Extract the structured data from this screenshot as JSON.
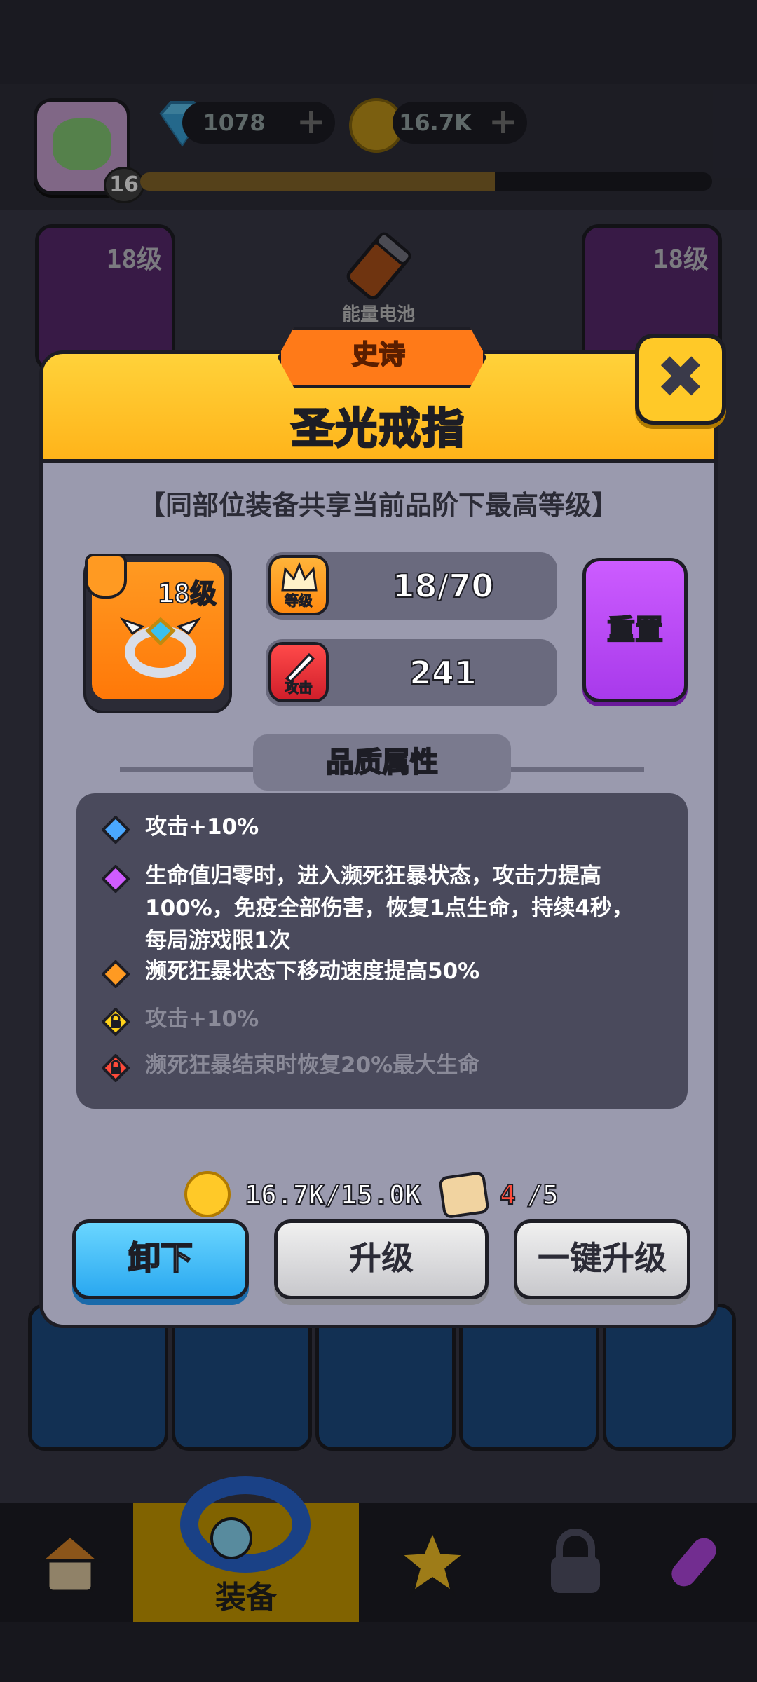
{
  "topbar": {
    "player_level": "16",
    "gems": "1078",
    "gold": "16.7K",
    "xp_progress": 0.62
  },
  "background": {
    "cards": [
      {
        "label": "18级",
        "color": "purple"
      },
      {
        "label": "18级",
        "color": "purple"
      }
    ],
    "battery_label": "能量电池"
  },
  "dialog": {
    "rarity": "史诗",
    "title": "圣光戒指",
    "share_note": "【同部位装备共享当前品阶下最高等级】",
    "item": {
      "level_label": "18级",
      "icon": "ring-icon"
    },
    "stats": {
      "level": {
        "icon_label": "等级",
        "value": "18/70"
      },
      "attack": {
        "icon_label": "攻击",
        "value": "241"
      }
    },
    "reset_label": "重置",
    "quality_header": "品质属性",
    "attributes": [
      {
        "text": "攻击+10%",
        "bullet": "blue-diamond",
        "locked": false
      },
      {
        "text": "生命值归零时，进入濒死狂暴状态，攻击力提高",
        "bullet": "purple-diamond",
        "locked": false
      },
      {
        "text": "100%，免疫全部伤害，恢复1点生命，持续4秒，",
        "bullet": "",
        "locked": false
      },
      {
        "text": "每局游戏限1次",
        "bullet": "",
        "locked": false
      },
      {
        "text": "濒死狂暴状态下移动速度提高50%",
        "bullet": "orange-diamond",
        "locked": false
      },
      {
        "text": "攻击+10%",
        "bullet": "yellow-lock",
        "locked": true
      },
      {
        "text": "濒死狂暴结束时恢复20%最大生命",
        "bullet": "red-lock",
        "locked": true
      }
    ],
    "cost": {
      "gold": "16.7K/15.0K",
      "scroll_have": "4",
      "scroll_need": "/5"
    },
    "buttons": {
      "unequip": "卸下",
      "upgrade": "升级",
      "max_upgrade": "一键升级"
    }
  },
  "bottom_nav": {
    "equipment_label": "装备"
  },
  "colors": {
    "header_yellow": "#ffc928",
    "rarity_orange": "#ff7a18",
    "reset_purple": "#b84af0",
    "unequip_blue": "#2aa8f0"
  }
}
